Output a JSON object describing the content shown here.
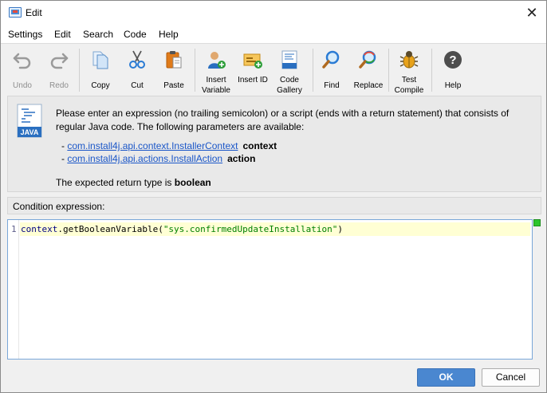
{
  "window": {
    "title": "Edit",
    "close_glyph": "✕"
  },
  "menu": [
    {
      "label": "Settings"
    },
    {
      "label": "Edit"
    },
    {
      "label": "Search"
    },
    {
      "label": "Code"
    },
    {
      "label": "Help"
    }
  ],
  "toolbar": {
    "undo": "Undo",
    "redo": "Redo",
    "copy": "Copy",
    "cut": "Cut",
    "paste": "Paste",
    "insert_variable": "Insert Variable",
    "insert_id": "Insert ID",
    "code_gallery": "Code Gallery",
    "find": "Find",
    "replace": "Replace",
    "test_compile": "Test Compile",
    "help": "Help"
  },
  "info": {
    "description": "Please enter an expression (no trailing semicolon) or a script (ends with a return statement) that consists of regular Java code. The following parameters are available:",
    "params": [
      {
        "type": "com.install4j.api.context.InstallerContext",
        "name": "context"
      },
      {
        "type": "com.install4j.api.actions.InstallAction",
        "name": "action"
      }
    ],
    "return_prefix": "The expected return type is ",
    "return_type": "boolean",
    "java_badge": "JAVA"
  },
  "condition": {
    "label": "Condition expression:"
  },
  "editor": {
    "line_number": "1",
    "code_ident": "context",
    "code_method": ".getBooleanVariable(",
    "code_string": "\"sys.confirmedUpdateInstallation\"",
    "code_close": ")"
  },
  "buttons": {
    "ok": "OK",
    "cancel": "Cancel"
  },
  "colors": {
    "ok_button": "#4a87d0",
    "link": "#1a56c8",
    "status_ok": "#2cc52c",
    "current_line": "#ffffd4"
  }
}
